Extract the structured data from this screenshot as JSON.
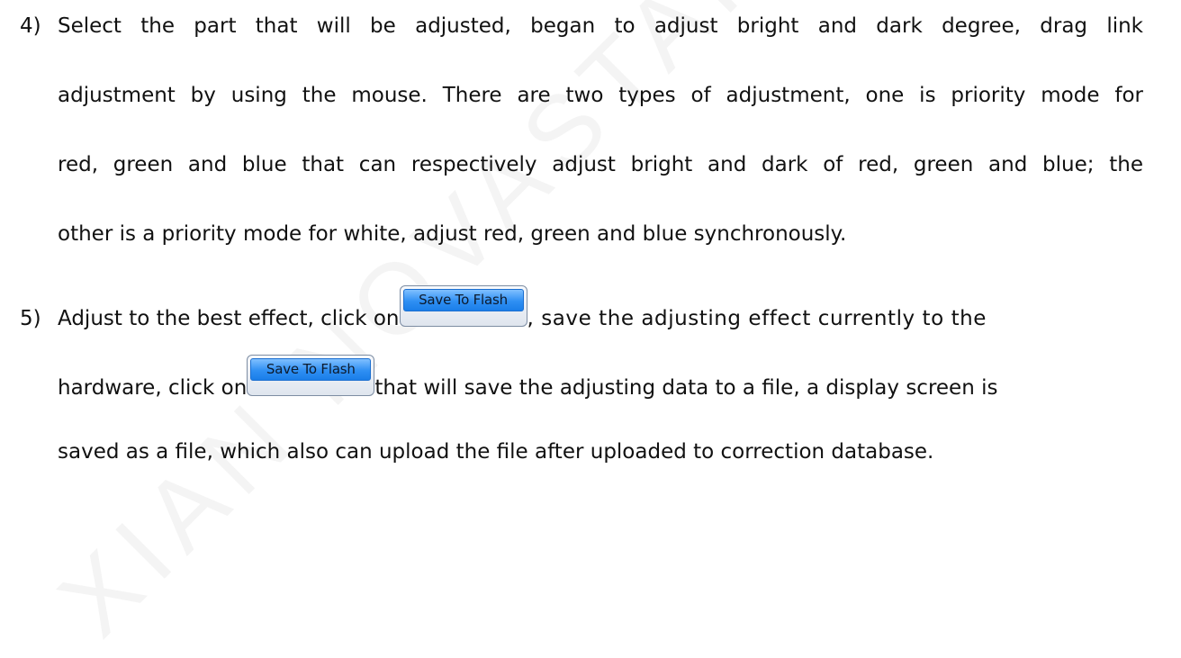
{
  "watermark": "XIAN NOVASTAR",
  "steps": [
    {
      "number": "4)",
      "lines": [
        "Select the part that will be adjusted, began to adjust bright and dark degree, drag link",
        "adjustment by using the mouse. There are two types of adjustment, one is priority mode for",
        "red, green and blue that can respectively adjust bright and dark of red, green and blue; the",
        "other is a priority mode for white, adjust red, green and blue synchronously."
      ]
    },
    {
      "number": "5)",
      "line1_before": "Adjust to the best effect, click on",
      "line1_after": ", save the adjusting effect currently to the",
      "line2_before": "hardware, click on",
      "line2_after": "that will save the adjusting data to a file, a display screen is",
      "line3": "saved as a file, which also can upload the file after uploaded to correction database.",
      "button1_label": "Save To Flash",
      "button2_label": "Save To Flash"
    }
  ]
}
